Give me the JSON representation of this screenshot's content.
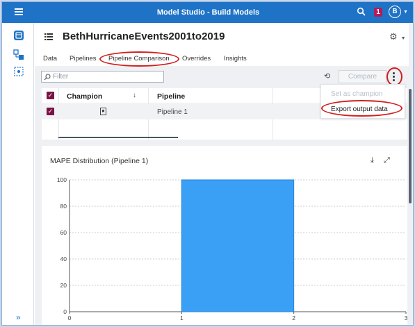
{
  "app": {
    "title": "Model Studio - Build Models",
    "notification_count": "1",
    "user_initial": "B"
  },
  "project": {
    "title": "BethHurricaneEvents2001to2019"
  },
  "tabs": [
    {
      "label": "Data"
    },
    {
      "label": "Pipelines"
    },
    {
      "label": "Pipeline Comparison",
      "active": true
    },
    {
      "label": "Overrides"
    },
    {
      "label": "Insights"
    }
  ],
  "toolbar": {
    "filter_placeholder": "Filter",
    "compare_label": "Compare"
  },
  "table": {
    "columns": [
      "Champion",
      "Pipeline"
    ],
    "rows": [
      {
        "pipeline": "Pipeline 1"
      }
    ]
  },
  "menu": {
    "items": [
      "Set as champion",
      "Export output data"
    ]
  },
  "chart_title": "MAPE Distribution (Pipeline 1)",
  "chart_data": {
    "type": "bar",
    "title": "MAPE Distribution (Pipeline 1)",
    "bins": [
      {
        "from": 1,
        "to": 2,
        "value": 100
      }
    ],
    "x_ticks": [
      "0",
      "1",
      "2",
      "3"
    ],
    "y_ticks": [
      "0",
      "20",
      "40",
      "60",
      "80",
      "100"
    ],
    "xlim": [
      0,
      3
    ],
    "ylim": [
      0,
      100
    ],
    "grid": true,
    "bar_color": "#3aa0f5"
  },
  "colors": {
    "brand_bar": "#1f73c6",
    "highlight_oval": "#d11f1f",
    "checkbox": "#7a1346"
  },
  "nav": {
    "expand_glyph": "»"
  },
  "icons": [
    "hamburger-icon",
    "search-icon",
    "gear-icon",
    "refresh-icon",
    "kebab-icon",
    "download-icon",
    "expand-icon"
  ]
}
